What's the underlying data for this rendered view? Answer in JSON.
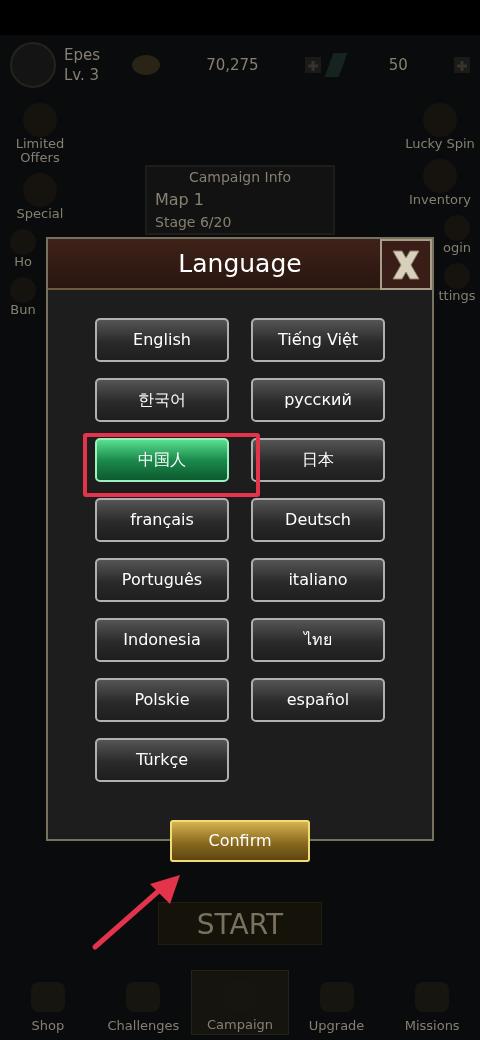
{
  "background": {
    "player": {
      "name": "Epes",
      "level": "Lv. 3"
    },
    "currencies": [
      {
        "kind": "coin",
        "value": "70,275"
      },
      {
        "kind": "gem",
        "value": "50"
      }
    ],
    "side_left": [
      {
        "label": "Limited Offers"
      },
      {
        "label": "Special"
      },
      {
        "label": "Ho"
      },
      {
        "label": "Bun"
      }
    ],
    "side_right": [
      {
        "label": "Lucky Spin"
      },
      {
        "label": "Inventory"
      },
      {
        "label": "ogin"
      },
      {
        "label": "ttings"
      }
    ],
    "campaign_info": {
      "title": "Campaign Info",
      "map": "Map 1",
      "stage": "Stage 6/20"
    },
    "start_button": "START",
    "nav": [
      {
        "label": "Shop",
        "selected": false
      },
      {
        "label": "Challenges",
        "selected": false
      },
      {
        "label": "Campaign",
        "selected": true
      },
      {
        "label": "Upgrade",
        "selected": false
      },
      {
        "label": "Missions",
        "selected": false
      }
    ]
  },
  "dialog": {
    "title": "Language",
    "languages": [
      {
        "label": "English",
        "selected": false
      },
      {
        "label": "Tiếng Việt",
        "selected": false
      },
      {
        "label": "한국어",
        "selected": false
      },
      {
        "label": "русский",
        "selected": false
      },
      {
        "label": "中国人",
        "selected": true
      },
      {
        "label": "日本",
        "selected": false
      },
      {
        "label": "français",
        "selected": false
      },
      {
        "label": "Deutsch",
        "selected": false
      },
      {
        "label": "Português",
        "selected": false
      },
      {
        "label": "italiano",
        "selected": false
      },
      {
        "label": "Indonesia",
        "selected": false
      },
      {
        "label": "ไทย",
        "selected": false
      },
      {
        "label": "Polskie",
        "selected": false
      },
      {
        "label": "español",
        "selected": false
      },
      {
        "label": "Türkçe",
        "selected": false
      }
    ],
    "confirm": "Confirm"
  }
}
